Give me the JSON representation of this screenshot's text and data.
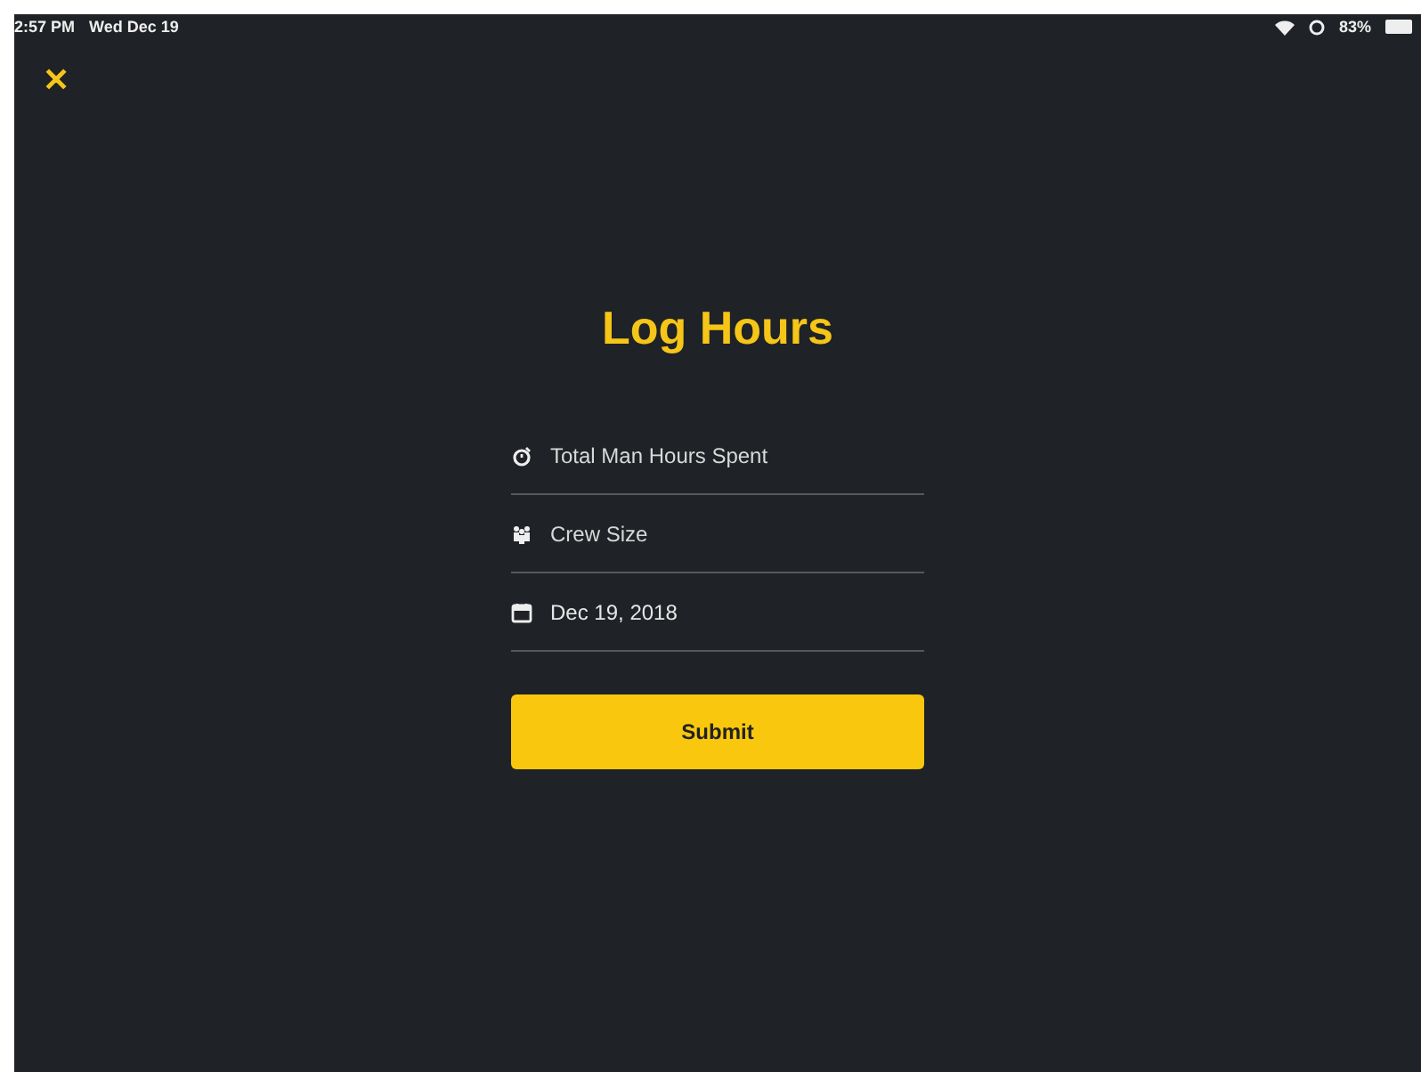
{
  "status_bar": {
    "time": "2:57 PM",
    "date": "Wed Dec 19",
    "battery": "83%"
  },
  "close_button": {
    "label": "✕"
  },
  "title": "Log Hours",
  "fields": [
    {
      "kind": "hours",
      "placeholder": "Total Man Hours Spent"
    },
    {
      "kind": "crew",
      "placeholder": "Crew Size"
    },
    {
      "kind": "date",
      "value": "Dec 19, 2018"
    }
  ],
  "submit_button": {
    "label": "Submit"
  }
}
